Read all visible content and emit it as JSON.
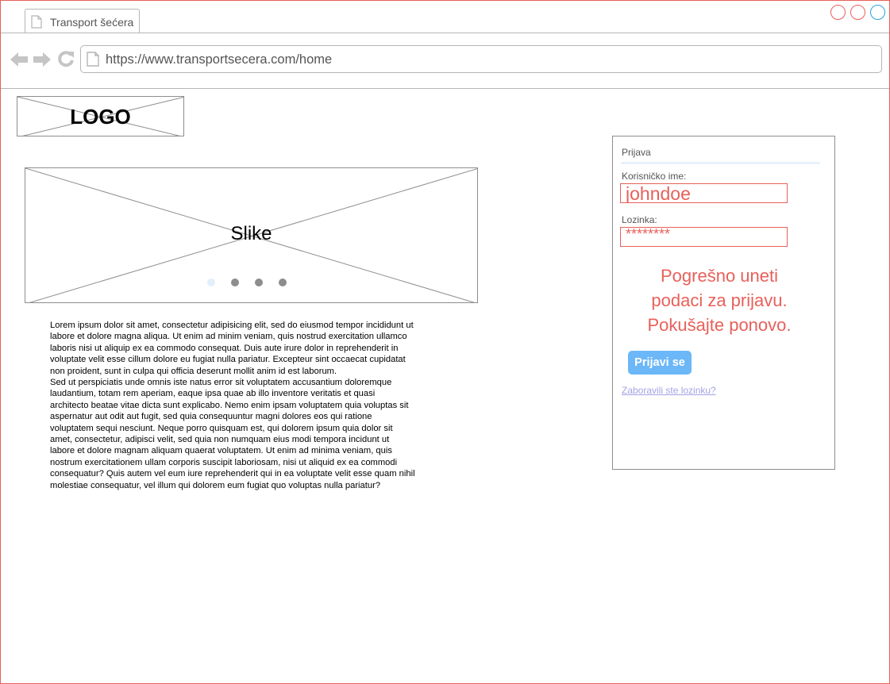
{
  "window": {
    "tab_title": "Transport šećera",
    "url": "https://www.transportsecera.com/home"
  },
  "page": {
    "logo_text": "LOGO",
    "slider_label": "Slike",
    "slider": {
      "dots": 4,
      "active_index": 0
    },
    "paragraph_1": "Lorem ipsum dolor sit amet, consectetur adipisicing elit, sed do eiusmod tempor incididunt ut labore et dolore magna aliqua. Ut enim ad minim veniam, quis nostrud exercitation ullamco laboris nisi ut aliquip ex ea commodo consequat. Duis aute irure dolor in reprehenderit in voluptate velit esse cillum dolore eu fugiat nulla pariatur. Excepteur sint occaecat cupidatat non proident, sunt in culpa qui officia deserunt mollit anim id est laborum.",
    "paragraph_2": "Sed ut perspiciatis unde omnis iste natus error sit voluptatem accusantium doloremque laudantium, totam rem aperiam, eaque ipsa quae ab illo inventore veritatis et quasi architecto beatae vitae dicta sunt explicabo. Nemo enim ipsam voluptatem quia voluptas sit aspernatur aut odit aut fugit, sed quia consequuntur magni dolores eos qui ratione voluptatem sequi nesciunt. Neque porro quisquam est, qui dolorem ipsum quia dolor sit amet, consectetur, adipisci velit, sed quia non numquam eius modi tempora incidunt ut labore et dolore magnam aliquam quaerat voluptatem. Ut enim ad minima veniam, quis nostrum exercitationem ullam corporis suscipit laboriosam, nisi ut aliquid ex ea commodi consequatur? Quis autem vel eum iure reprehenderit qui in ea voluptate velit esse quam nihil molestiae consequatur, vel illum qui dolorem eum fugiat quo voluptas nulla pariatur?"
  },
  "login": {
    "title": "Prijava",
    "username_label": "Korisničko ime:",
    "username_value": "johndoe",
    "password_label": "Lozinka:",
    "password_value": "********",
    "error_line_1": "Pogrešno uneti",
    "error_line_2": "podaci za prijavu.",
    "error_line_3": "Pokušajte ponovo.",
    "submit_label": "Prijavi se",
    "forgot_link": "Zaboravili ste lozinku?"
  },
  "colors": {
    "error": "#e8605a",
    "button": "#6cb7f7",
    "link": "#a4a2e3",
    "border": "#8d8d8d",
    "active_dot": "#e3eefb",
    "window_button_blue": "#2aa3e0"
  },
  "icons": [
    "back-arrow-icon",
    "forward-arrow-icon",
    "reload-icon",
    "page-icon"
  ]
}
